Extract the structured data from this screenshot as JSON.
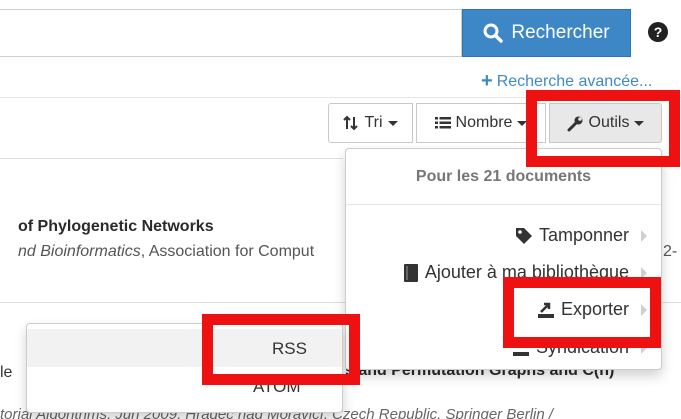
{
  "search": {
    "button_label": "Rechercher",
    "help_icon_text": "?",
    "advanced_label": "Recherche avancée..."
  },
  "toolbar": {
    "sort_label": "Tri",
    "count_label": "Nombre",
    "tools_label": "Outils"
  },
  "tools_menu": {
    "header": "Pour les 21 documents",
    "items": [
      {
        "label": "Tamponner",
        "icon": "tag-icon"
      },
      {
        "label": "Ajouter à ma bibliothèque",
        "icon": "book-icon"
      },
      {
        "label": "Exporter",
        "icon": "export-icon"
      },
      {
        "label": "Syndication",
        "icon": "rss-icon"
      }
    ]
  },
  "syndication_menu": {
    "items": [
      {
        "label": "RSS"
      },
      {
        "label": "ATOM"
      }
    ]
  },
  "results": {
    "r1_title": "of Phylogenetic Networks",
    "r1_sub_italic": "nd Bioinformatics",
    "r1_sub_rest": ", Association for Comput",
    "r1_frag": "2-",
    "r2_left": "le",
    "r2_right": "s and Permutation Graphs and C(n)",
    "r3": "torial Algorithms, Jun 2009, Hradec nad Moravicí, Czech Republic. Springer Berlin /"
  },
  "colors": {
    "primary": "#3d87c7",
    "link": "#3f8ac4",
    "highlight": "#ee1111"
  }
}
